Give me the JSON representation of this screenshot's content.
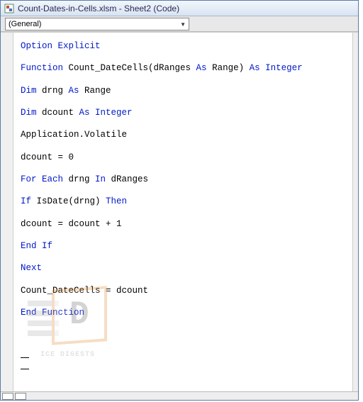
{
  "window": {
    "title": "Count-Dates-in-Cells.xlsm - Sheet2 (Code)"
  },
  "dropdown": {
    "scope": "(General)"
  },
  "code": {
    "lines": [
      [
        {
          "t": "Option Explicit",
          "c": "kw"
        }
      ],
      [],
      [
        {
          "t": "Function ",
          "c": "kw"
        },
        {
          "t": "Count_DateCells(dRanges ",
          "c": "txt"
        },
        {
          "t": "As ",
          "c": "kw"
        },
        {
          "t": "Range) ",
          "c": "txt"
        },
        {
          "t": "As Integer",
          "c": "kw"
        }
      ],
      [],
      [
        {
          "t": "Dim ",
          "c": "kw"
        },
        {
          "t": "drng ",
          "c": "txt"
        },
        {
          "t": "As ",
          "c": "kw"
        },
        {
          "t": "Range",
          "c": "txt"
        }
      ],
      [],
      [
        {
          "t": "Dim ",
          "c": "kw"
        },
        {
          "t": "dcount ",
          "c": "txt"
        },
        {
          "t": "As Integer",
          "c": "kw"
        }
      ],
      [],
      [
        {
          "t": "Application.Volatile",
          "c": "txt"
        }
      ],
      [],
      [
        {
          "t": "dcount = 0",
          "c": "txt"
        }
      ],
      [],
      [
        {
          "t": "For Each ",
          "c": "kw"
        },
        {
          "t": "drng ",
          "c": "txt"
        },
        {
          "t": "In ",
          "c": "kw"
        },
        {
          "t": "dRanges",
          "c": "txt"
        }
      ],
      [],
      [
        {
          "t": "If ",
          "c": "kw"
        },
        {
          "t": "IsDate(drng) ",
          "c": "txt"
        },
        {
          "t": "Then",
          "c": "kw"
        }
      ],
      [],
      [
        {
          "t": "dcount = dcount + 1",
          "c": "txt"
        }
      ],
      [],
      [
        {
          "t": "End If",
          "c": "kw"
        }
      ],
      [],
      [
        {
          "t": "Next",
          "c": "kw"
        }
      ],
      [],
      [
        {
          "t": "Count_DateCells = dcount",
          "c": "txt"
        }
      ],
      [],
      [
        {
          "t": "End Function",
          "c": "kw"
        }
      ]
    ]
  },
  "watermark": {
    "letter": "D",
    "text": "ICE DIGESTS"
  }
}
